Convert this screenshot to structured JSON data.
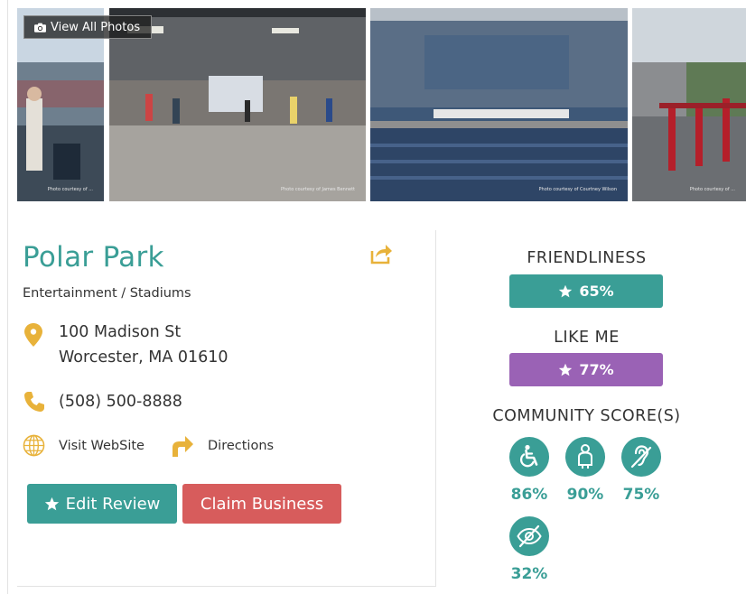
{
  "gallery": {
    "view_all_label": "View All Photos",
    "photos": [
      {
        "credit": "Photo courtesy of ..."
      },
      {
        "credit": "Photo courtesy of James Bennett"
      },
      {
        "credit": "Photo courtesy of Courtney Wilson"
      },
      {
        "credit": "Photo courtesy of ..."
      }
    ]
  },
  "business": {
    "name": "Polar Park",
    "category": "Entertainment / Stadiums",
    "address_line1": "100 Madison St",
    "address_line2": "Worcester, MA 01610",
    "phone": "(508) 500-8888",
    "website_label": "Visit WebSite",
    "directions_label": "Directions"
  },
  "actions": {
    "edit_review_label": "Edit Review",
    "claim_business_label": "Claim Business"
  },
  "scores": {
    "friendliness_label": "FRIENDLINESS",
    "friendliness_value": "65%",
    "like_me_label": "LIKE ME",
    "like_me_value": "77%",
    "community_label": "COMMUNITY SCORE(S)",
    "community": [
      {
        "icon": "wheelchair-icon",
        "value": "86%"
      },
      {
        "icon": "person-body-icon",
        "value": "90%"
      },
      {
        "icon": "hearing-impaired-icon",
        "value": "75%"
      },
      {
        "icon": "vision-impaired-icon",
        "value": "32%"
      }
    ]
  },
  "colors": {
    "teal": "#3a9e96",
    "purple": "#9a62b5",
    "red": "#d75c5c",
    "gold": "#e8b23a"
  }
}
